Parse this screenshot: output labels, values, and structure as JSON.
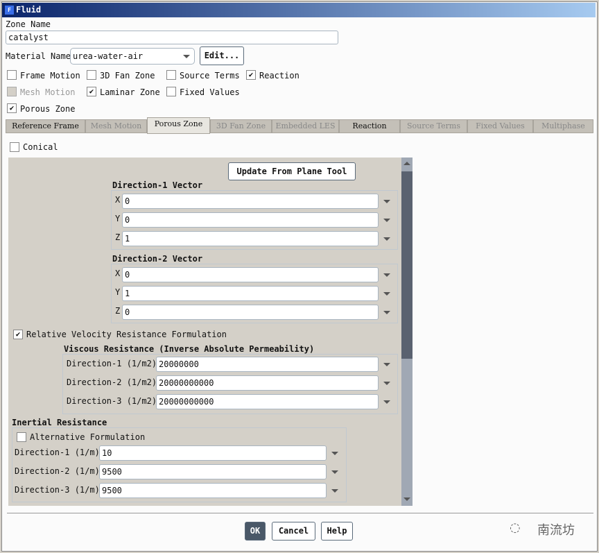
{
  "window": {
    "title": "Fluid",
    "icon": "F"
  },
  "zone_name": {
    "label": "Zone Name",
    "value": "catalyst"
  },
  "material": {
    "label": "Material Name",
    "value": "urea-water-air",
    "edit": "Edit..."
  },
  "options": [
    {
      "label": "Frame Motion",
      "checked": false
    },
    {
      "label": "3D Fan Zone",
      "checked": false
    },
    {
      "label": "Source Terms",
      "checked": false
    },
    {
      "label": "Reaction",
      "checked": true
    },
    {
      "label": "Mesh Motion",
      "checked": false,
      "disabled": true
    },
    {
      "label": "Laminar Zone",
      "checked": true
    },
    {
      "label": "Fixed Values",
      "checked": false
    },
    {
      "label": "Porous Zone",
      "checked": true
    }
  ],
  "tabs": [
    "Reference Frame",
    "Mesh Motion",
    "Porous Zone",
    "3D Fan Zone",
    "Embedded LES",
    "Reaction",
    "Source Terms",
    "Fixed Values",
    "Multiphase"
  ],
  "porous": {
    "conical": "Conical",
    "update_btn": "Update From Plane Tool",
    "dir1": {
      "title": "Direction-1 Vector",
      "x": "0",
      "y": "0",
      "z": "1"
    },
    "dir2": {
      "title": "Direction-2 Vector",
      "x": "0",
      "y": "1",
      "z": "0"
    },
    "axes": [
      "X",
      "Y",
      "Z"
    ],
    "relative": "Relative Velocity Resistance Formulation",
    "viscous": {
      "title": "Viscous Resistance (Inverse Absolute Permeability)",
      "labels": [
        "Direction-1 (1/m2)",
        "Direction-2 (1/m2)",
        "Direction-3 (1/m2)"
      ],
      "values": [
        "20000000",
        "20000000000",
        "20000000000"
      ]
    },
    "inertial": {
      "title": "Inertial Resistance",
      "alt": "Alternative Formulation",
      "labels": [
        "Direction-1 (1/m)",
        "Direction-2 (1/m)",
        "Direction-3 (1/m)"
      ],
      "values": [
        "10",
        "9500",
        "9500"
      ]
    }
  },
  "buttons": {
    "ok": "OK",
    "cancel": "Cancel",
    "help": "Help"
  },
  "watermark": "南流坊"
}
